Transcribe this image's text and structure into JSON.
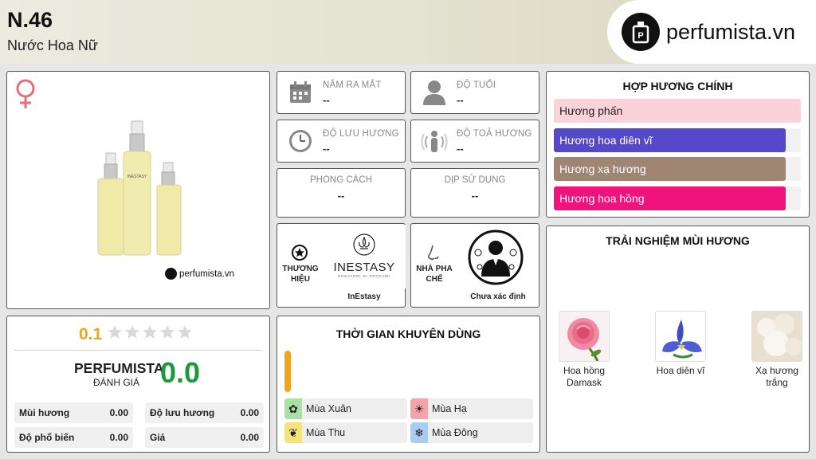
{
  "header": {
    "title": "N.46",
    "subtitle": "Nước Hoa Nữ",
    "logo_text": "perfumista.vn"
  },
  "product": {
    "gender_icon": "female-icon",
    "watermark": "perfumista.vn",
    "bottle_brand": "INESTASY"
  },
  "info": {
    "release_label": "NĂM RA MẮT",
    "release_value": "--",
    "age_label": "ĐỘ TUỔI",
    "age_value": "--",
    "longevity_label": "ĐỘ LƯU HƯƠNG",
    "longevity_value": "--",
    "sillage_label": "ĐỘ TOẢ HƯƠNG",
    "sillage_value": "--",
    "style_label": "PHONG CÁCH",
    "style_value": "--",
    "occasion_label": "DỊP SỬ DỤNG",
    "occasion_value": "--"
  },
  "brand": {
    "label_line1": "THƯƠNG",
    "label_line2": "HIỆU",
    "logo_main": "INESTASY",
    "logo_sub": "CREATORI DI PROFUMI",
    "name": "InEstasy"
  },
  "perfumer": {
    "label_line1": "NHÀ PHA",
    "label_line2": "CHẾ",
    "name": "Chưa xác định"
  },
  "accords": {
    "title": "HỢP HƯƠNG CHÍNH",
    "items": [
      {
        "label": "Hương phấn",
        "color": "#f9d2da",
        "text_color": "#222",
        "fill": 1.0
      },
      {
        "label": "Hương hoa diên vĩ",
        "color": "#5649c9",
        "text_color": "#ffffff",
        "fill": 0.94
      },
      {
        "label": "Hương xạ hương",
        "color": "#a08672",
        "text_color": "#ffffff",
        "fill": 0.94
      },
      {
        "label": "Hương hoa hồng",
        "color": "#f0127d",
        "text_color": "#ffffff",
        "fill": 0.94
      }
    ]
  },
  "rating": {
    "user_score": "0.1",
    "stars": 5,
    "brand_label": "PERFUMISTA",
    "brand_sub": "ĐÁNH GIÁ",
    "score": "0.0",
    "accent": "#1a9a3a",
    "stats": [
      {
        "label": "Mùi hương",
        "value": "0.00"
      },
      {
        "label": "Độ lưu hương",
        "value": "0.00"
      },
      {
        "label": "Độ phổ biến",
        "value": "0.00"
      },
      {
        "label": "Giá",
        "value": "0.00"
      }
    ]
  },
  "season": {
    "title": "THỜI GIAN KHUYÊN DÙNG",
    "items": [
      {
        "label": "Mùa Xuân",
        "icon": "spring-icon",
        "color": "#a9e0a4"
      },
      {
        "label": "Mùa Hạ",
        "icon": "summer-sun-icon",
        "color": "#f4a3a8"
      },
      {
        "label": "Mùa Thu",
        "icon": "autumn-leaf-icon",
        "color": "#f7e27a"
      },
      {
        "label": "Mùa Đông",
        "icon": "winter-snowflake-icon",
        "color": "#a8cdf2"
      }
    ]
  },
  "notes": {
    "title": "TRẢI NGHIỆM MÙI HƯƠNG",
    "items": [
      {
        "label_line1": "Hoa hồng",
        "label_line2": "Damask"
      },
      {
        "label_line1": "Hoa diên vĩ",
        "label_line2": ""
      },
      {
        "label_line1": "Xạ hương",
        "label_line2": "trắng"
      }
    ]
  }
}
